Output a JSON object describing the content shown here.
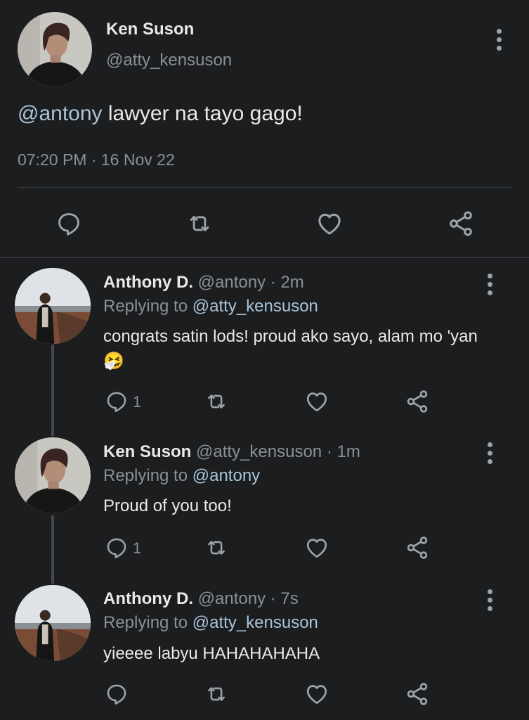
{
  "main_tweet": {
    "name": "Ken Suson",
    "handle": "@atty_kensuson",
    "mention": "@antony",
    "text": " lawyer na tayo gago!",
    "timestamp": "07:20 PM · 16 Nov 22"
  },
  "replies": [
    {
      "name": "Anthony D.",
      "handle": "@antony",
      "time": "· 2m",
      "replying_label": "Replying to",
      "replying_to": "@atty_kensuson",
      "text": "congrats satin lods! proud ako sayo, alam mo 'yan",
      "emoji": "🤧",
      "reply_count": "1"
    },
    {
      "name": "Ken Suson",
      "handle": "@atty_kensuson",
      "time": "· 1m",
      "replying_label": "Replying to",
      "replying_to": "@antony",
      "text": "Proud of you too!",
      "reply_count": "1"
    },
    {
      "name": "Anthony D.",
      "handle": "@antony",
      "time": "· 7s",
      "replying_label": "Replying to",
      "replying_to": "@atty_kensuson",
      "text": "yieeee labyu HAHAHAHAHA",
      "reply_count": ""
    }
  ],
  "icons": [
    "reply-icon",
    "retweet-icon",
    "like-icon",
    "share-icon",
    "more-options-icon"
  ],
  "colors": {
    "background": "#1c1d1f",
    "link": "#a9c4d8",
    "muted": "#8b9096"
  }
}
